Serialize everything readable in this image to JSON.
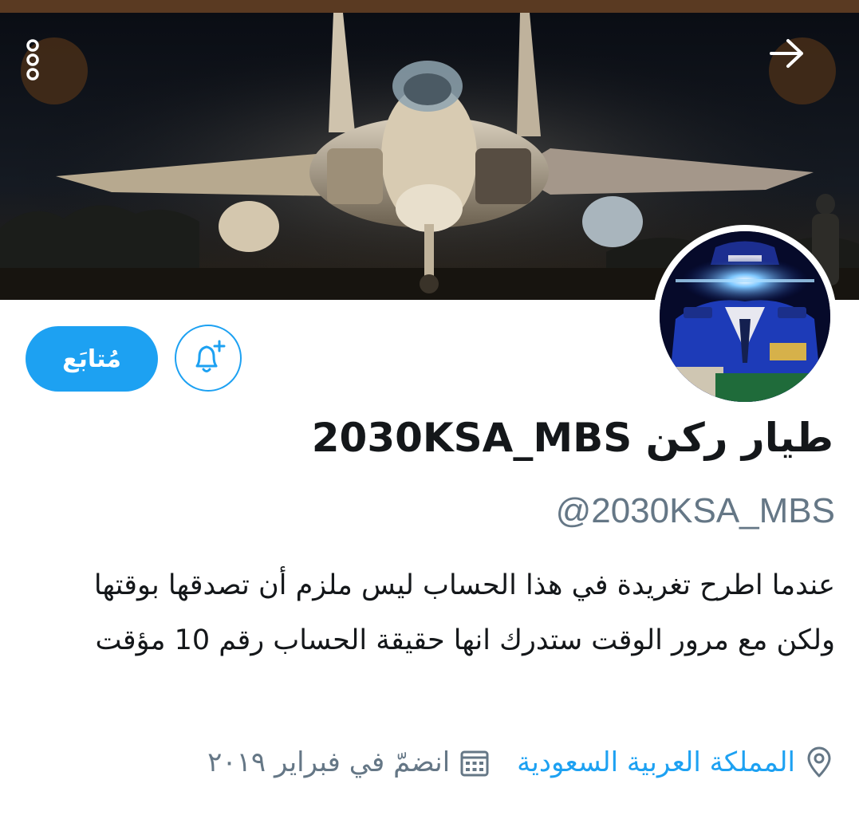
{
  "colors": {
    "accent": "#1da1f2",
    "muted": "#657786",
    "text": "#14171a",
    "banner_overlay": "#5a3a22"
  },
  "header": {
    "more_icon": "more-vertical-icon",
    "back_icon": "arrow-right-icon"
  },
  "actions": {
    "follow_label": "مُتابَع",
    "notify_icon": "bell-plus-icon"
  },
  "profile": {
    "display_name": "طيار ركن 2030KSA_MBS",
    "handle": "@2030KSA_MBS",
    "bio": "عندما اطرح تغريدة في هذا الحساب ليس ملزم أن تصدقها بوقتها ولكن مع مرور الوقت ستدرك انها حقيقة الحساب رقم 10 مؤقت",
    "location": "المملكة العربية السعودية",
    "location_icon": "location-pin-icon",
    "joined": "انضمّ في فبراير ٢٠١٩",
    "joined_icon": "calendar-icon"
  }
}
